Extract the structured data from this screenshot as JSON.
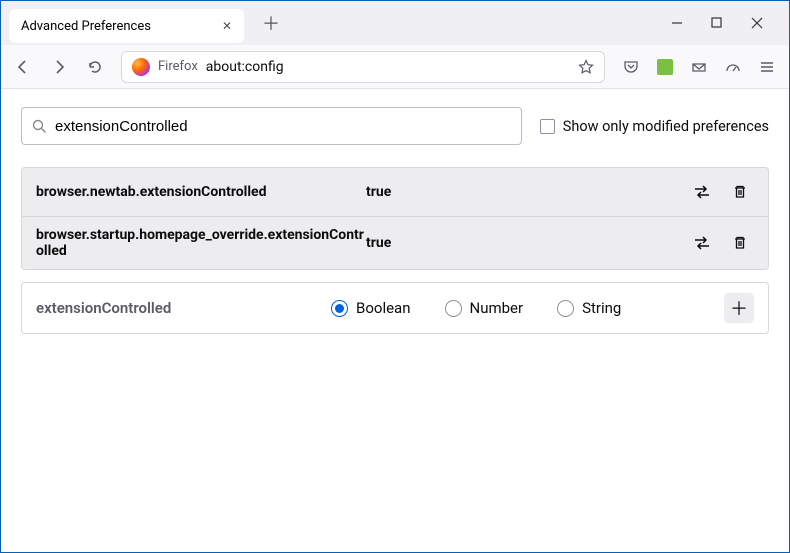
{
  "titlebar": {
    "tab_title": "Advanced Preferences"
  },
  "toolbar": {
    "addr_label": "Firefox",
    "addr_url": "about:config"
  },
  "search": {
    "value": "extensionControlled",
    "checkbox_label": "Show only modified preferences"
  },
  "prefs": [
    {
      "name": "browser.newtab.extensionControlled",
      "value": "true"
    },
    {
      "name": "browser.startup.homepage_override.extensionControlled",
      "value": "true"
    }
  ],
  "add": {
    "name": "extensionControlled",
    "types": {
      "boolean": "Boolean",
      "number": "Number",
      "string": "String"
    },
    "selected": "boolean"
  }
}
